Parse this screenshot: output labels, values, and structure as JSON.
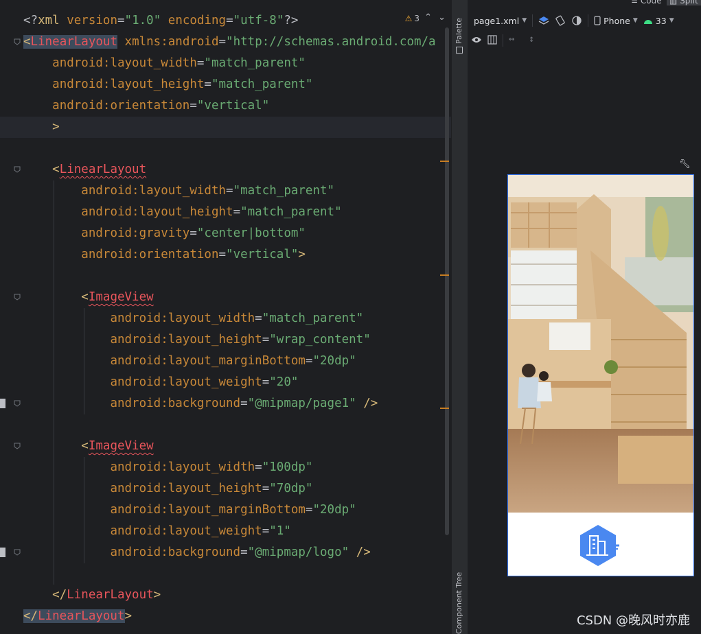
{
  "editor": {
    "warnings_count": "3",
    "lines": [
      [
        [
          "plain",
          "<?"
        ],
        [
          "tag",
          "xml "
        ],
        [
          "ns",
          "version"
        ],
        [
          "plain",
          "="
        ],
        [
          "val",
          "\"1.0\""
        ],
        [
          "plain",
          " "
        ],
        [
          "ns",
          "encoding"
        ],
        [
          "plain",
          "="
        ],
        [
          "val",
          "\"utf-8\""
        ],
        [
          "plain",
          "?>"
        ]
      ],
      [
        [
          "tag",
          "<"
        ],
        [
          "tagname",
          "LinearLayout"
        ],
        [
          "plain",
          " "
        ],
        [
          "ns",
          "xmlns:android"
        ],
        [
          "plain",
          "="
        ],
        [
          "val",
          "\"http://schemas.android.com/a"
        ]
      ],
      [
        [
          "plain",
          "    "
        ],
        [
          "ns",
          "android:layout_width"
        ],
        [
          "plain",
          "="
        ],
        [
          "val",
          "\"match_parent\""
        ]
      ],
      [
        [
          "plain",
          "    "
        ],
        [
          "ns",
          "android:layout_height"
        ],
        [
          "plain",
          "="
        ],
        [
          "val",
          "\"match_parent\""
        ]
      ],
      [
        [
          "plain",
          "    "
        ],
        [
          "ns",
          "android:orientation"
        ],
        [
          "plain",
          "="
        ],
        [
          "val",
          "\"vertical\""
        ]
      ],
      [
        [
          "plain",
          "    "
        ],
        [
          "tag",
          ">"
        ]
      ],
      [],
      [
        [
          "plain",
          "    "
        ],
        [
          "tag",
          "<"
        ],
        [
          "tagname",
          "LinearLayout"
        ]
      ],
      [
        [
          "plain",
          "        "
        ],
        [
          "ns",
          "android:layout_width"
        ],
        [
          "plain",
          "="
        ],
        [
          "val",
          "\"match_parent\""
        ]
      ],
      [
        [
          "plain",
          "        "
        ],
        [
          "ns",
          "android:layout_height"
        ],
        [
          "plain",
          "="
        ],
        [
          "val",
          "\"match_parent\""
        ]
      ],
      [
        [
          "plain",
          "        "
        ],
        [
          "ns",
          "android:gravity"
        ],
        [
          "plain",
          "="
        ],
        [
          "val",
          "\"center|bottom\""
        ]
      ],
      [
        [
          "plain",
          "        "
        ],
        [
          "ns",
          "android:orientation"
        ],
        [
          "plain",
          "="
        ],
        [
          "val",
          "\"vertical\""
        ],
        [
          "tag",
          ">"
        ]
      ],
      [],
      [
        [
          "plain",
          "        "
        ],
        [
          "tag",
          "<"
        ],
        [
          "tagname",
          "ImageView"
        ]
      ],
      [
        [
          "plain",
          "            "
        ],
        [
          "ns",
          "android:layout_width"
        ],
        [
          "plain",
          "="
        ],
        [
          "val",
          "\"match_parent\""
        ]
      ],
      [
        [
          "plain",
          "            "
        ],
        [
          "ns",
          "android:layout_height"
        ],
        [
          "plain",
          "="
        ],
        [
          "val",
          "\"wrap_content\""
        ]
      ],
      [
        [
          "plain",
          "            "
        ],
        [
          "ns",
          "android:layout_marginBottom"
        ],
        [
          "plain",
          "="
        ],
        [
          "val",
          "\"20dp\""
        ]
      ],
      [
        [
          "plain",
          "            "
        ],
        [
          "ns",
          "android:layout_weight"
        ],
        [
          "plain",
          "="
        ],
        [
          "val",
          "\"20\""
        ]
      ],
      [
        [
          "plain",
          "            "
        ],
        [
          "ns",
          "android:background"
        ],
        [
          "plain",
          "="
        ],
        [
          "val",
          "\"@mipmap/page1\""
        ],
        [
          "plain",
          " "
        ],
        [
          "tag",
          "/>"
        ]
      ],
      [],
      [
        [
          "plain",
          "        "
        ],
        [
          "tag",
          "<"
        ],
        [
          "tagname",
          "ImageView"
        ]
      ],
      [
        [
          "plain",
          "            "
        ],
        [
          "ns",
          "android:layout_width"
        ],
        [
          "plain",
          "="
        ],
        [
          "val",
          "\"100dp\""
        ]
      ],
      [
        [
          "plain",
          "            "
        ],
        [
          "ns",
          "android:layout_height"
        ],
        [
          "plain",
          "="
        ],
        [
          "val",
          "\"70dp\""
        ]
      ],
      [
        [
          "plain",
          "            "
        ],
        [
          "ns",
          "android:layout_marginBottom"
        ],
        [
          "plain",
          "="
        ],
        [
          "val",
          "\"20dp\""
        ]
      ],
      [
        [
          "plain",
          "            "
        ],
        [
          "ns",
          "android:layout_weight"
        ],
        [
          "plain",
          "="
        ],
        [
          "val",
          "\"1\""
        ]
      ],
      [
        [
          "plain",
          "            "
        ],
        [
          "ns",
          "android:background"
        ],
        [
          "plain",
          "="
        ],
        [
          "val",
          "\"@mipmap/logo\""
        ],
        [
          "plain",
          " "
        ],
        [
          "tag",
          "/>"
        ]
      ],
      [],
      [
        [
          "plain",
          "    "
        ],
        [
          "tag",
          "</"
        ],
        [
          "tagname",
          "LinearLayout"
        ],
        [
          "tag",
          ">"
        ]
      ],
      [
        [
          "tag",
          "</"
        ],
        [
          "tagname",
          "LinearLayout"
        ],
        [
          "tag",
          ">"
        ]
      ]
    ]
  },
  "sidebar": {
    "palette_label": "Palette",
    "tree_label": "Component Tree"
  },
  "topbar": {
    "code_label": "Code",
    "split_label": "Split"
  },
  "design_toolbar": {
    "file_label": "page1.xml",
    "device_label": "Phone",
    "api_label": "33"
  },
  "watermark": "CSDN @晚风时亦鹿",
  "colors": {
    "accent": "#3574f0",
    "logo_blue": "#4a88f0",
    "warning": "#f0a732"
  }
}
